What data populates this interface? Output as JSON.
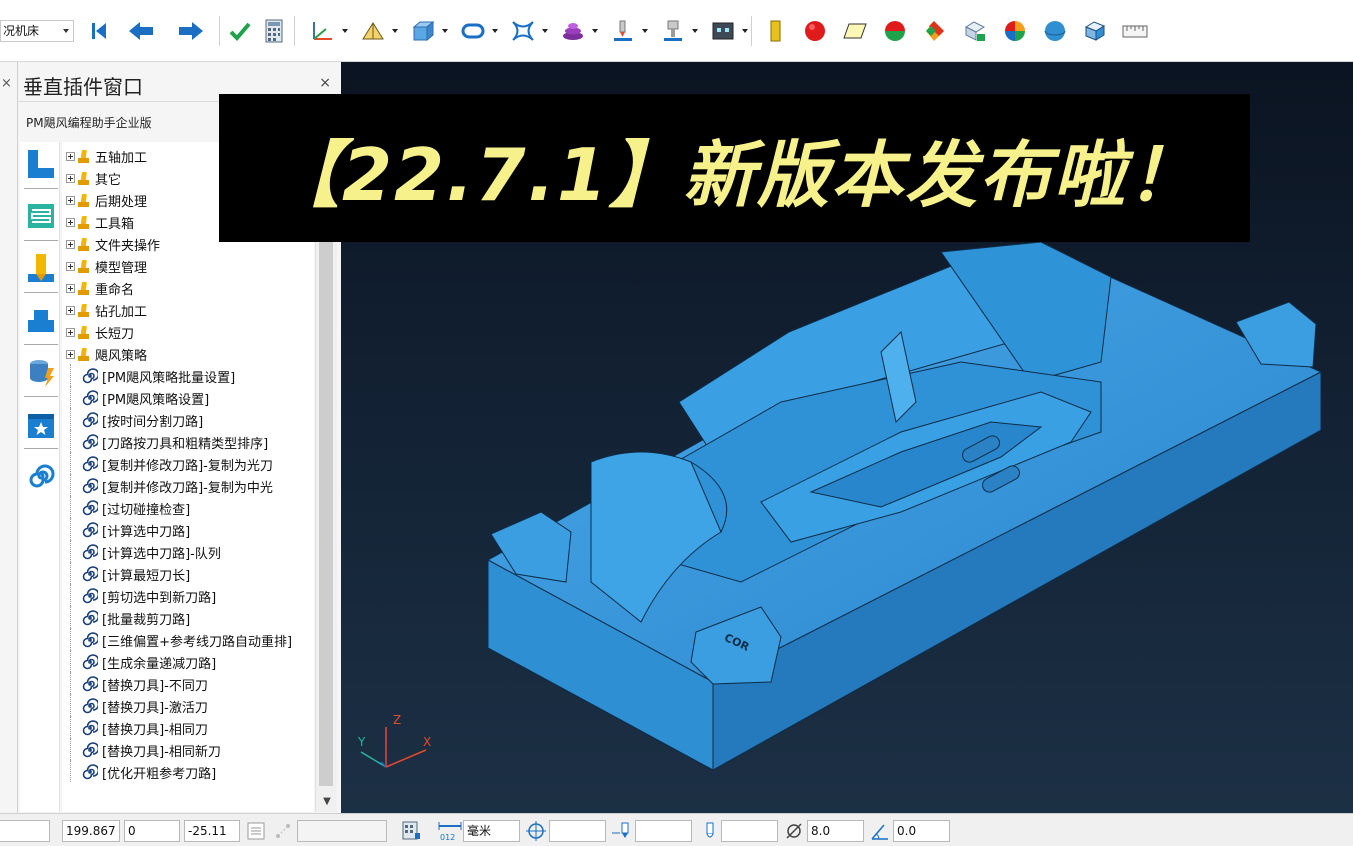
{
  "toolbar": {
    "machine_combo": "况机床",
    "tools": [
      "first-icon",
      "back-icon",
      "forward-icon",
      "check-icon",
      "calculator-icon",
      "workplane-icon",
      "toolpath-icon",
      "block-icon",
      "boundary-icon",
      "pattern-icon",
      "stock-icon",
      "tool-icon",
      "holder-icon",
      "display-icon",
      "yellow-bar-icon",
      "red-sphere-icon",
      "plane-icon",
      "half-sphere-icon",
      "shading-icon",
      "material-icon",
      "multicolor-icon",
      "blue-sphere-icon",
      "box-icon",
      "ruler-icon"
    ]
  },
  "panel": {
    "title": "垂直插件窗口",
    "close": "×",
    "tab": "PM飓风编程助手企业版",
    "left_close": "×",
    "rail": [
      "corner-icon",
      "layers-icon",
      "drill-icon",
      "step-icon",
      "stack-icon",
      "star-folder-icon",
      "spiral-icon"
    ],
    "folders": [
      "五轴加工",
      "其它",
      "后期处理",
      "工具箱",
      "文件夹操作",
      "模型管理",
      "重命名",
      "钻孔加工",
      "长短刀",
      "飓风策略"
    ],
    "items": [
      "[PM飓风策略批量设置]",
      "[PM飓风策略设置]",
      "[按时间分割刀路]",
      "[刀路按刀具和粗精类型排序]",
      "[复制并修改刀路]-复制为光刀",
      "[复制并修改刀路]-复制为中光",
      "[过切碰撞检查]",
      "[计算选中刀路]",
      "[计算选中刀路]-队列",
      "[计算最短刀长]",
      "[剪切选中到新刀路]",
      "[批量裁剪刀路]",
      "[三维偏置+参考线刀路自动重排]",
      "[生成余量递减刀路]",
      "[替换刀具]-不同刀",
      "[替换刀具]-激活刀",
      "[替换刀具]-相同刀",
      "[替换刀具]-相同新刀",
      "[优化开粗参考刀路]"
    ]
  },
  "viewport": {
    "banner": "【22.7.1】新版本发布啦！",
    "model_label": "COR",
    "axes": {
      "x": "X",
      "y": "Y",
      "z": "Z"
    },
    "background_color": "#142437",
    "model_color": "#2f8fd0"
  },
  "status": {
    "x": "199.867",
    "y": "0",
    "z": "-25.11",
    "unit": "毫米",
    "diameter": "8.0",
    "angle": "0.0"
  }
}
